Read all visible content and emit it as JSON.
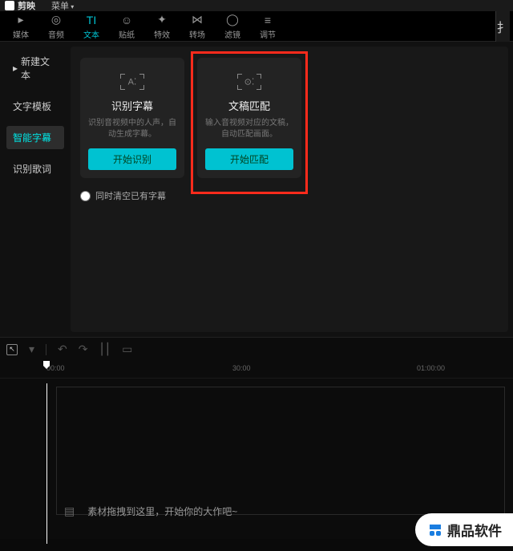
{
  "titlebar": {
    "brand": "剪映",
    "menu": "菜单"
  },
  "toolbar": {
    "items": [
      {
        "label": "媒体",
        "icon": "▸"
      },
      {
        "label": "音频",
        "icon": "◎"
      },
      {
        "label": "文本",
        "icon": "TI"
      },
      {
        "label": "贴纸",
        "icon": "☺"
      },
      {
        "label": "特效",
        "icon": "✦"
      },
      {
        "label": "转场",
        "icon": "⋈"
      },
      {
        "label": "滤镜",
        "icon": "◯"
      },
      {
        "label": "调节",
        "icon": "≡"
      }
    ],
    "right_icon": "扌"
  },
  "sidebar": {
    "items": [
      {
        "label": "新建文本",
        "prefix": "▸"
      },
      {
        "label": "文字模板"
      },
      {
        "label": "智能字幕"
      },
      {
        "label": "识别歌词"
      }
    ]
  },
  "cards": [
    {
      "title": "识别字幕",
      "desc": "识别音视频中的人声，自动生成字幕。",
      "button": "开始识别",
      "icon": "A⁚"
    },
    {
      "title": "文稿匹配",
      "desc": "输入音视频对应的文稿，自动匹配画面。",
      "button": "开始匹配",
      "icon": "⊙⁚"
    }
  ],
  "checkbox_label": "同时清空已有字幕",
  "timeline": {
    "ticks": [
      {
        "pos": 58,
        "label": "00:00"
      },
      {
        "pos": 290,
        "label": "30:00"
      },
      {
        "pos": 520,
        "label": "01:00:00"
      }
    ],
    "drop_hint": "素材拖拽到这里，开始你的大作吧~"
  },
  "watermark": "鼎品软件"
}
